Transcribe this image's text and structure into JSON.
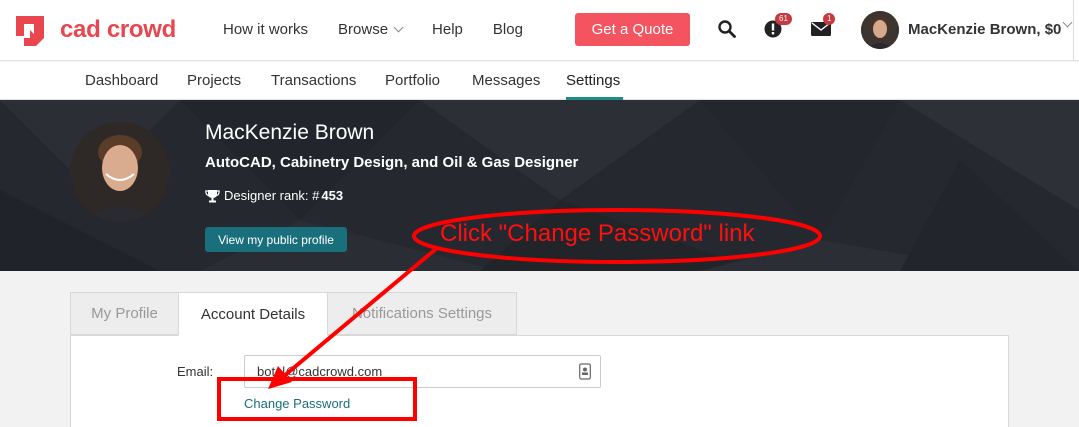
{
  "header": {
    "logo_text": "cad crowd",
    "nav": [
      "How it works",
      "Browse",
      "Help",
      "Blog"
    ],
    "quote_button": "Get a Quote",
    "alerts_count": "61",
    "messages_count": "1",
    "user_label": "MacKenzie Brown, $0",
    "brand_color": "#e8474f"
  },
  "subnav": {
    "items": [
      "Dashboard",
      "Projects",
      "Transactions",
      "Portfolio",
      "Messages",
      "Settings"
    ],
    "active": "Settings"
  },
  "hero": {
    "name": "MacKenzie Brown",
    "title": "AutoCAD, Cabinetry Design, and Oil & Gas Designer",
    "rank_label": "Designer rank: #",
    "rank_value": "453",
    "profile_button": "View my public profile"
  },
  "tabs": [
    {
      "label": "My Profile",
      "active": false
    },
    {
      "label": "Account Details",
      "active": true
    },
    {
      "label": "Notifications Settings",
      "active": false
    }
  ],
  "form": {
    "email_label": "Email:",
    "email_value": "botal@cadcrowd.com",
    "change_password_link": "Change Password"
  },
  "annotation": {
    "callout": "Click \"Change Password\" link",
    "color": "#ff0000"
  }
}
